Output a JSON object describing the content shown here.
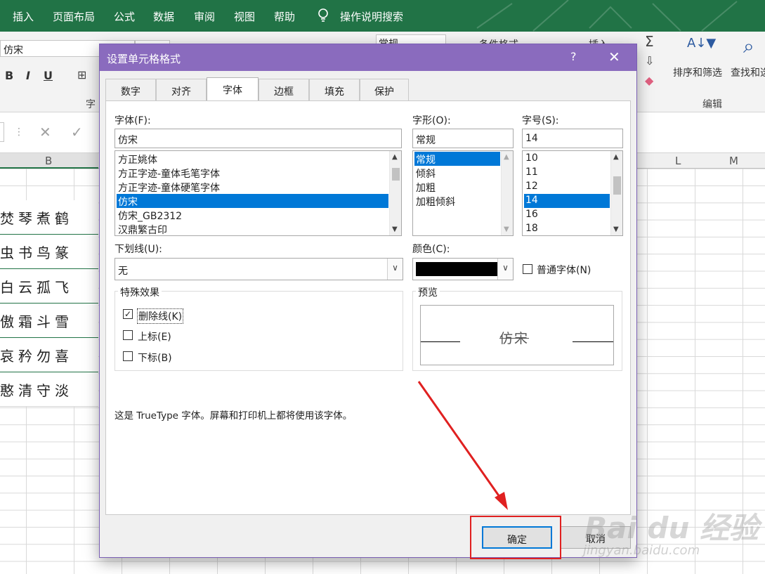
{
  "menubar": {
    "tabs": [
      "插入",
      "页面布局",
      "公式",
      "数据",
      "审阅",
      "视图",
      "帮助"
    ],
    "search": "操作说明搜索"
  },
  "ribbon": {
    "font_name": "仿宋",
    "bold": "B",
    "italic": "I",
    "underline": "U",
    "font_group_label": "字",
    "number_format": "常规",
    "conditional_format": "条件格式",
    "insert": "插入",
    "sum": "Σ",
    "sort_filter": "排序和筛选",
    "find_select": "查找和选",
    "edit_group": "编辑"
  },
  "sheet": {
    "col_b": "B",
    "col_l": "L",
    "col_m": "M",
    "rows": [
      "焚琴煮鹤",
      "虫书鸟篆",
      "白云孤飞",
      "傲霜斗雪",
      "哀矜勿喜",
      "憨清守淡"
    ]
  },
  "dialog": {
    "title": "设置单元格格式",
    "help": "?",
    "close": "✕",
    "tabs": [
      "数字",
      "对齐",
      "字体",
      "边框",
      "填充",
      "保护"
    ],
    "font_label": "字体(F):",
    "font_value": "仿宋",
    "font_list": [
      "方正姚体",
      "方正字迹-童体毛笔字体",
      "方正字迹-童体硬笔字体",
      "仿宋",
      "仿宋_GB2312",
      "汉鼎繁古印"
    ],
    "style_label": "字形(O):",
    "style_value": "常规",
    "style_list": [
      "常规",
      "倾斜",
      "加粗",
      "加粗倾斜"
    ],
    "size_label": "字号(S):",
    "size_value": "14",
    "size_list": [
      "10",
      "11",
      "12",
      "14",
      "16",
      "18"
    ],
    "underline_label": "下划线(U):",
    "underline_value": "无",
    "color_label": "颜色(C):",
    "normal_font": "普通字体(N)",
    "effects_label": "特殊效果",
    "strikethrough": "删除线(K)",
    "superscript": "上标(E)",
    "subscript": "下标(B)",
    "preview_label": "预览",
    "preview_text": "仿宋",
    "info": "这是 TrueType 字体。屏幕和打印机上都将使用该字体。",
    "ok": "确定",
    "cancel": "取消"
  },
  "watermark": {
    "brand": "Bai du 经验",
    "url": "jingyan.baidu.com"
  }
}
